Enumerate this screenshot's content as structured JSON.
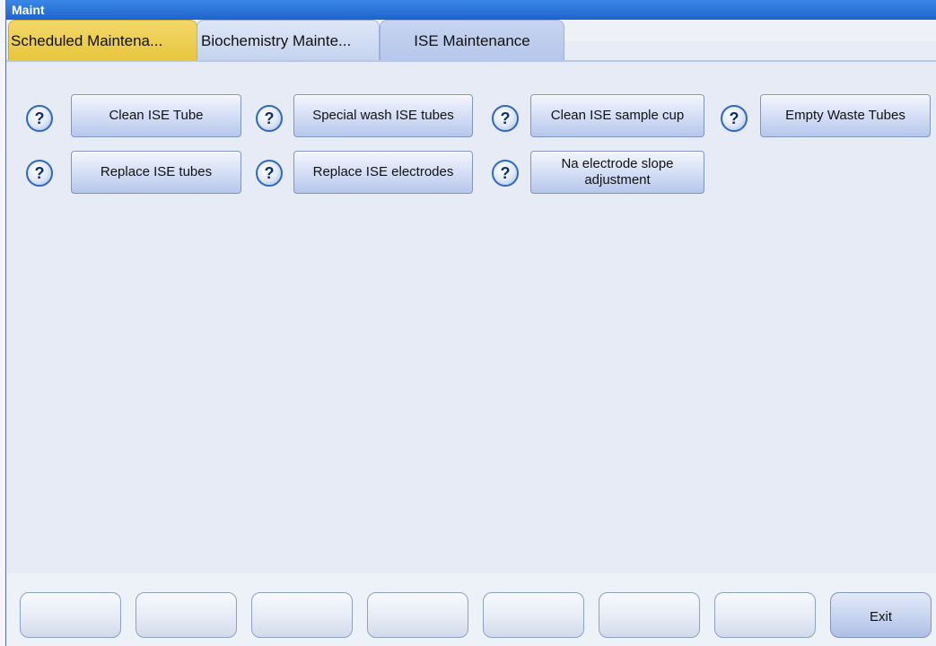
{
  "window": {
    "title": "Maint"
  },
  "tabs": [
    {
      "label": "Scheduled Maintena...",
      "state": "active"
    },
    {
      "label": "Biochemistry Mainte...",
      "state": "normal"
    },
    {
      "label": "ISE Maintenance",
      "state": "normal"
    }
  ],
  "actions": [
    {
      "help_icon": "question-mark-icon",
      "label": "Clean ISE Tube"
    },
    {
      "help_icon": "question-mark-icon",
      "label": "Special wash ISE tubes"
    },
    {
      "help_icon": "question-mark-icon",
      "label": "Clean ISE sample cup"
    },
    {
      "help_icon": "question-mark-icon",
      "label": "Empty Waste Tubes"
    },
    {
      "help_icon": "question-mark-icon",
      "label": "Replace ISE tubes"
    },
    {
      "help_icon": "question-mark-icon",
      "label": "Replace ISE electrodes"
    },
    {
      "help_icon": "question-mark-icon",
      "label": "Na electrode slope adjustment"
    }
  ],
  "bottom_buttons": [
    {
      "label": ""
    },
    {
      "label": ""
    },
    {
      "label": ""
    },
    {
      "label": ""
    },
    {
      "label": ""
    },
    {
      "label": ""
    },
    {
      "label": ""
    },
    {
      "label": "Exit"
    }
  ],
  "colors": {
    "titlebar": "#1e63cc",
    "active_tab": "#e7c53b",
    "tab_inactive": "#b6c7ec",
    "button": "#d8e1f7",
    "help_icon_border": "#2f67c5"
  }
}
